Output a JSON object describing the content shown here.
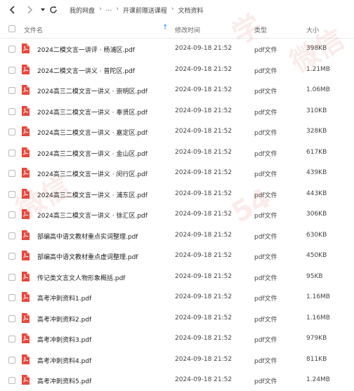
{
  "breadcrumb": [
    "我的网盘",
    "...",
    "开课前赠送课程",
    "文档资料"
  ],
  "header": {
    "name": "文件名",
    "modified": "修改时间",
    "type": "类型",
    "size": "大小"
  },
  "files": [
    {
      "name": "2024二模文言一讲评 · 杨浦区.pdf",
      "date": "2024-09-18 21:52",
      "type": "pdf文件",
      "size": "398KB"
    },
    {
      "name": "2024二模文言一讲义 · 普陀区.pdf",
      "date": "2024-09-18 21:52",
      "type": "pdf文件",
      "size": "1.21MB"
    },
    {
      "name": "2024高三二模文言一讲义 · 崇明区.pdf",
      "date": "2024-09-18 21:52",
      "type": "pdf文件",
      "size": "1.06MB"
    },
    {
      "name": "2024高三二模文言一讲义 · 奉贤区.pdf",
      "date": "2024-09-18 21:52",
      "type": "pdf文件",
      "size": "310KB"
    },
    {
      "name": "2024高三二模文言一讲义 · 嘉定区.pdf",
      "date": "2024-09-18 21:52",
      "type": "pdf文件",
      "size": "328KB"
    },
    {
      "name": "2024高三二模文言一讲义 · 金山区.pdf",
      "date": "2024-09-18 21:52",
      "type": "pdf文件",
      "size": "617KB"
    },
    {
      "name": "2024高三二模文言一讲义 · 闵行区.pdf",
      "date": "2024-09-18 21:52",
      "type": "pdf文件",
      "size": "439KB"
    },
    {
      "name": "2024高三二模文言一讲义 · 浦东区.pdf",
      "date": "2024-09-18 21:52",
      "type": "pdf文件",
      "size": "443KB"
    },
    {
      "name": "2024高三二模文言一讲义 · 徐汇区.pdf",
      "date": "2024-09-18 21:52",
      "type": "pdf文件",
      "size": "306KB"
    },
    {
      "name": "部编高中语文教材重点实词整理.pdf",
      "date": "2024-09-18 21:52",
      "type": "pdf文件",
      "size": "630KB"
    },
    {
      "name": "部编高中语文教材重点虚词整理.pdf",
      "date": "2024-09-18 21:52",
      "type": "pdf文件",
      "size": "450KB"
    },
    {
      "name": "传记类文言文人物形象概括.pdf",
      "date": "2024-09-18 21:52",
      "type": "pdf文件",
      "size": "95KB"
    },
    {
      "name": "高考冲刺资料1.pdf",
      "date": "2024-09-18 21:52",
      "type": "pdf文件",
      "size": "1.16MB"
    },
    {
      "name": "高考冲刺资料2.pdf",
      "date": "2024-09-18 21:52",
      "type": "pdf文件",
      "size": "1.16MB"
    },
    {
      "name": "高考冲刺资料3.pdf",
      "date": "2024-09-18 21:52",
      "type": "pdf文件",
      "size": "979KB"
    },
    {
      "name": "高考冲刺资料4.pdf",
      "date": "2024-09-18 21:52",
      "type": "pdf文件",
      "size": "811KB"
    },
    {
      "name": "高考冲刺资料5.pdf",
      "date": "2024-09-18 21:52",
      "type": "pdf文件",
      "size": "1.24MB"
    }
  ],
  "colors": {
    "pdf_red": "#e8473b",
    "sort_arrow": "#2f8ff5"
  }
}
